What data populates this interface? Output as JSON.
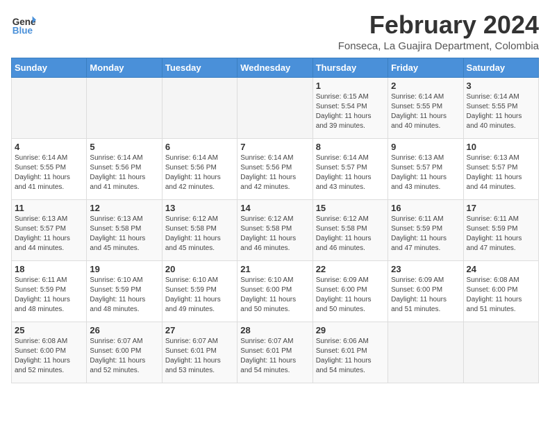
{
  "header": {
    "logo_general": "General",
    "logo_blue": "Blue",
    "title": "February 2024",
    "subtitle": "Fonseca, La Guajira Department, Colombia"
  },
  "columns": [
    "Sunday",
    "Monday",
    "Tuesday",
    "Wednesday",
    "Thursday",
    "Friday",
    "Saturday"
  ],
  "weeks": [
    [
      {
        "day": "",
        "info": ""
      },
      {
        "day": "",
        "info": ""
      },
      {
        "day": "",
        "info": ""
      },
      {
        "day": "",
        "info": ""
      },
      {
        "day": "1",
        "info": "Sunrise: 6:15 AM\nSunset: 5:54 PM\nDaylight: 11 hours\nand 39 minutes."
      },
      {
        "day": "2",
        "info": "Sunrise: 6:14 AM\nSunset: 5:55 PM\nDaylight: 11 hours\nand 40 minutes."
      },
      {
        "day": "3",
        "info": "Sunrise: 6:14 AM\nSunset: 5:55 PM\nDaylight: 11 hours\nand 40 minutes."
      }
    ],
    [
      {
        "day": "4",
        "info": "Sunrise: 6:14 AM\nSunset: 5:55 PM\nDaylight: 11 hours\nand 41 minutes."
      },
      {
        "day": "5",
        "info": "Sunrise: 6:14 AM\nSunset: 5:56 PM\nDaylight: 11 hours\nand 41 minutes."
      },
      {
        "day": "6",
        "info": "Sunrise: 6:14 AM\nSunset: 5:56 PM\nDaylight: 11 hours\nand 42 minutes."
      },
      {
        "day": "7",
        "info": "Sunrise: 6:14 AM\nSunset: 5:56 PM\nDaylight: 11 hours\nand 42 minutes."
      },
      {
        "day": "8",
        "info": "Sunrise: 6:14 AM\nSunset: 5:57 PM\nDaylight: 11 hours\nand 43 minutes."
      },
      {
        "day": "9",
        "info": "Sunrise: 6:13 AM\nSunset: 5:57 PM\nDaylight: 11 hours\nand 43 minutes."
      },
      {
        "day": "10",
        "info": "Sunrise: 6:13 AM\nSunset: 5:57 PM\nDaylight: 11 hours\nand 44 minutes."
      }
    ],
    [
      {
        "day": "11",
        "info": "Sunrise: 6:13 AM\nSunset: 5:57 PM\nDaylight: 11 hours\nand 44 minutes."
      },
      {
        "day": "12",
        "info": "Sunrise: 6:13 AM\nSunset: 5:58 PM\nDaylight: 11 hours\nand 45 minutes."
      },
      {
        "day": "13",
        "info": "Sunrise: 6:12 AM\nSunset: 5:58 PM\nDaylight: 11 hours\nand 45 minutes."
      },
      {
        "day": "14",
        "info": "Sunrise: 6:12 AM\nSunset: 5:58 PM\nDaylight: 11 hours\nand 46 minutes."
      },
      {
        "day": "15",
        "info": "Sunrise: 6:12 AM\nSunset: 5:58 PM\nDaylight: 11 hours\nand 46 minutes."
      },
      {
        "day": "16",
        "info": "Sunrise: 6:11 AM\nSunset: 5:59 PM\nDaylight: 11 hours\nand 47 minutes."
      },
      {
        "day": "17",
        "info": "Sunrise: 6:11 AM\nSunset: 5:59 PM\nDaylight: 11 hours\nand 47 minutes."
      }
    ],
    [
      {
        "day": "18",
        "info": "Sunrise: 6:11 AM\nSunset: 5:59 PM\nDaylight: 11 hours\nand 48 minutes."
      },
      {
        "day": "19",
        "info": "Sunrise: 6:10 AM\nSunset: 5:59 PM\nDaylight: 11 hours\nand 48 minutes."
      },
      {
        "day": "20",
        "info": "Sunrise: 6:10 AM\nSunset: 5:59 PM\nDaylight: 11 hours\nand 49 minutes."
      },
      {
        "day": "21",
        "info": "Sunrise: 6:10 AM\nSunset: 6:00 PM\nDaylight: 11 hours\nand 50 minutes."
      },
      {
        "day": "22",
        "info": "Sunrise: 6:09 AM\nSunset: 6:00 PM\nDaylight: 11 hours\nand 50 minutes."
      },
      {
        "day": "23",
        "info": "Sunrise: 6:09 AM\nSunset: 6:00 PM\nDaylight: 11 hours\nand 51 minutes."
      },
      {
        "day": "24",
        "info": "Sunrise: 6:08 AM\nSunset: 6:00 PM\nDaylight: 11 hours\nand 51 minutes."
      }
    ],
    [
      {
        "day": "25",
        "info": "Sunrise: 6:08 AM\nSunset: 6:00 PM\nDaylight: 11 hours\nand 52 minutes."
      },
      {
        "day": "26",
        "info": "Sunrise: 6:07 AM\nSunset: 6:00 PM\nDaylight: 11 hours\nand 52 minutes."
      },
      {
        "day": "27",
        "info": "Sunrise: 6:07 AM\nSunset: 6:01 PM\nDaylight: 11 hours\nand 53 minutes."
      },
      {
        "day": "28",
        "info": "Sunrise: 6:07 AM\nSunset: 6:01 PM\nDaylight: 11 hours\nand 54 minutes."
      },
      {
        "day": "29",
        "info": "Sunrise: 6:06 AM\nSunset: 6:01 PM\nDaylight: 11 hours\nand 54 minutes."
      },
      {
        "day": "",
        "info": ""
      },
      {
        "day": "",
        "info": ""
      }
    ]
  ]
}
